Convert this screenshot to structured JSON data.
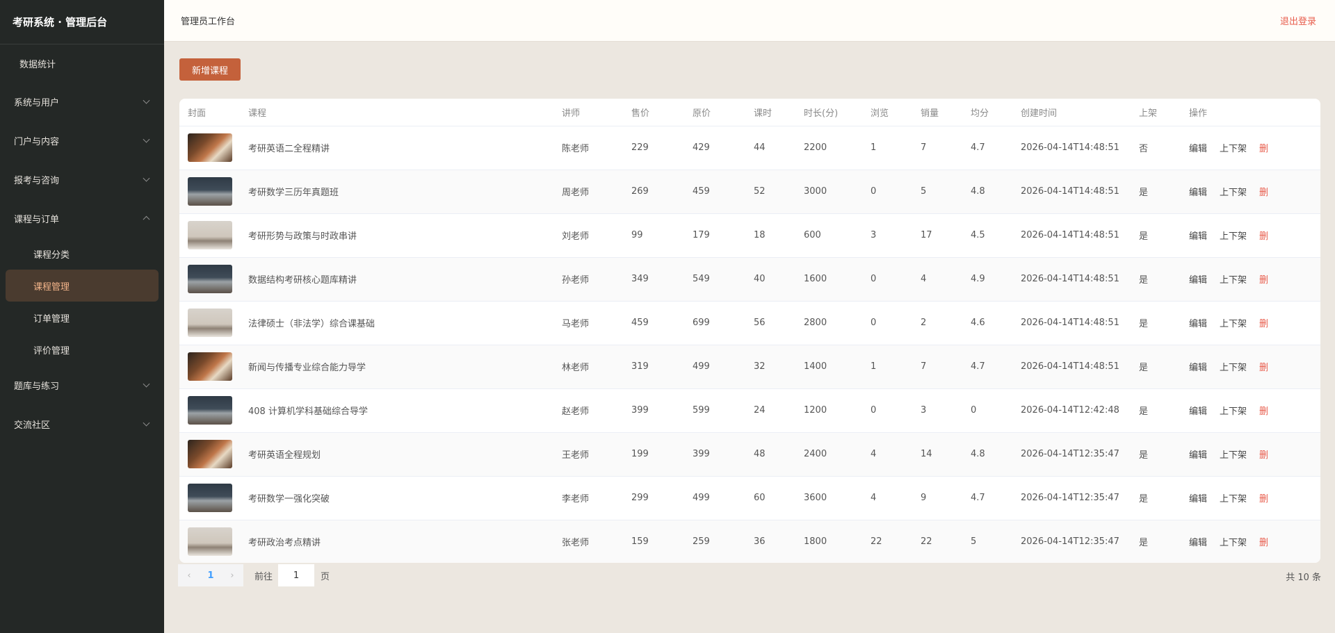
{
  "sidebar": {
    "brand": "考研系统 · 管理后台",
    "top_item": "数据统计",
    "groups": [
      {
        "label": "系统与用户",
        "expanded": false
      },
      {
        "label": "门户与内容",
        "expanded": false
      },
      {
        "label": "报考与咨询",
        "expanded": false
      },
      {
        "label": "课程与订单",
        "expanded": true
      }
    ],
    "sub_items": [
      "课程分类",
      "课程管理",
      "订单管理",
      "评价管理"
    ],
    "groups_after": [
      {
        "label": "题库与练习",
        "expanded": false
      },
      {
        "label": "交流社区",
        "expanded": false
      }
    ],
    "active_item": "课程管理"
  },
  "header": {
    "title": "管理员工作台",
    "logout": "退出登录"
  },
  "toolbar": {
    "add_label": "新增课程"
  },
  "table": {
    "headers": [
      "封面",
      "课程",
      "讲师",
      "售价",
      "原价",
      "课时",
      "时长(分)",
      "浏览",
      "销量",
      "均分",
      "创建时间",
      "上架",
      "操作"
    ],
    "actions": {
      "edit": "编辑",
      "toggle": "上下架",
      "delete": "删"
    },
    "rows": [
      {
        "cover": "warm",
        "course": "考研英语二全程精讲",
        "teacher": "陈老师",
        "price": "229",
        "orig": "429",
        "lessons": "44",
        "duration": "2200",
        "views": "1",
        "sales": "7",
        "score": "4.7",
        "created": "2026-04-14T14:48:51",
        "listed": "否"
      },
      {
        "cover": "dark",
        "course": "考研数学三历年真题班",
        "teacher": "周老师",
        "price": "269",
        "orig": "459",
        "lessons": "52",
        "duration": "3000",
        "views": "0",
        "sales": "5",
        "score": "4.8",
        "created": "2026-04-14T14:48:51",
        "listed": "是"
      },
      {
        "cover": "pale",
        "course": "考研形势与政策与时政串讲",
        "teacher": "刘老师",
        "price": "99",
        "orig": "179",
        "lessons": "18",
        "duration": "600",
        "views": "3",
        "sales": "17",
        "score": "4.5",
        "created": "2026-04-14T14:48:51",
        "listed": "是"
      },
      {
        "cover": "dark",
        "course": "数据结构考研核心题库精讲",
        "teacher": "孙老师",
        "price": "349",
        "orig": "549",
        "lessons": "40",
        "duration": "1600",
        "views": "0",
        "sales": "4",
        "score": "4.9",
        "created": "2026-04-14T14:48:51",
        "listed": "是"
      },
      {
        "cover": "pale",
        "course": "法律硕士（非法学）综合课基础",
        "teacher": "马老师",
        "price": "459",
        "orig": "699",
        "lessons": "56",
        "duration": "2800",
        "views": "0",
        "sales": "2",
        "score": "4.6",
        "created": "2026-04-14T14:48:51",
        "listed": "是"
      },
      {
        "cover": "warm",
        "course": "新闻与传播专业综合能力导学",
        "teacher": "林老师",
        "price": "319",
        "orig": "499",
        "lessons": "32",
        "duration": "1400",
        "views": "1",
        "sales": "7",
        "score": "4.7",
        "created": "2026-04-14T14:48:51",
        "listed": "是"
      },
      {
        "cover": "dark",
        "course": "408 计算机学科基础综合导学",
        "teacher": "赵老师",
        "price": "399",
        "orig": "599",
        "lessons": "24",
        "duration": "1200",
        "views": "0",
        "sales": "3",
        "score": "0",
        "created": "2026-04-14T12:42:48",
        "listed": "是"
      },
      {
        "cover": "warm",
        "course": "考研英语全程规划",
        "teacher": "王老师",
        "price": "199",
        "orig": "399",
        "lessons": "48",
        "duration": "2400",
        "views": "4",
        "sales": "14",
        "score": "4.8",
        "created": "2026-04-14T12:35:47",
        "listed": "是"
      },
      {
        "cover": "dark",
        "course": "考研数学一强化突破",
        "teacher": "李老师",
        "price": "299",
        "orig": "499",
        "lessons": "60",
        "duration": "3600",
        "views": "4",
        "sales": "9",
        "score": "4.7",
        "created": "2026-04-14T12:35:47",
        "listed": "是"
      },
      {
        "cover": "pale",
        "course": "考研政治考点精讲",
        "teacher": "张老师",
        "price": "159",
        "orig": "259",
        "lessons": "36",
        "duration": "1800",
        "views": "22",
        "sales": "22",
        "score": "5",
        "created": "2026-04-14T12:35:47",
        "listed": "是"
      }
    ]
  },
  "pagination": {
    "current_page": "1",
    "goto_label": "前往",
    "goto_value": "1",
    "page_unit": "页",
    "total": "共 10 条"
  }
}
